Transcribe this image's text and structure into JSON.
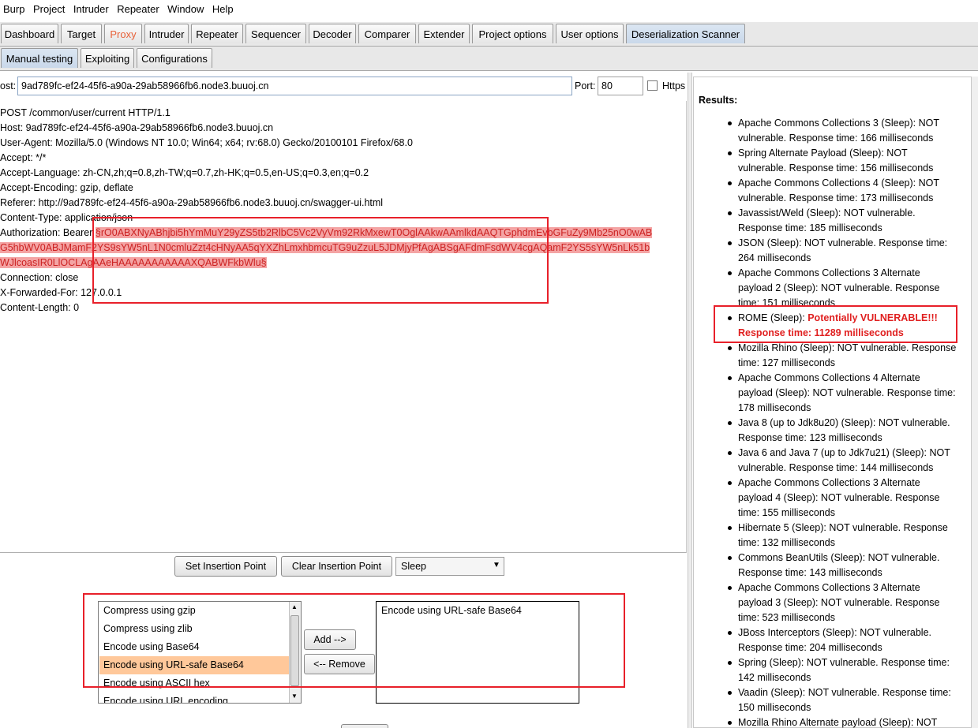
{
  "menu": [
    "Burp",
    "Project",
    "Intruder",
    "Repeater",
    "Window",
    "Help"
  ],
  "main_tabs": [
    "Dashboard",
    "Target",
    "Proxy",
    "Intruder",
    "Repeater",
    "Sequencer",
    "Decoder",
    "Comparer",
    "Extender",
    "Project options",
    "User options",
    "Deserialization Scanner"
  ],
  "sub_tabs": [
    "Manual testing",
    "Exploiting",
    "Configurations"
  ],
  "host": {
    "label": "ost:",
    "value": "9ad789fc-ef24-45f6-a90a-29ab58966fb6.node3.buuoj.cn",
    "port_label": "Port:",
    "port_value": "80",
    "https_label": "Https"
  },
  "request": {
    "l1": "POST /common/user/current HTTP/1.1",
    "l2": "Host: 9ad789fc-ef24-45f6-a90a-29ab58966fb6.node3.buuoj.cn",
    "l3": "User-Agent: Mozilla/5.0 (Windows NT 10.0; Win64; x64; rv:68.0) Gecko/20100101 Firefox/68.0",
    "l4": "Accept: */*",
    "l5": "Accept-Language: zh-CN,zh;q=0.8,zh-TW;q=0.7,zh-HK;q=0.5,en-US;q=0.3,en;q=0.2",
    "l6": "Accept-Encoding: gzip, deflate",
    "l7": "Referer: http://9ad789fc-ef24-45f6-a90a-29ab58966fb6.node3.buuoj.cn/swagger-ui.html",
    "l8": "Content-Type: application/json",
    "auth_prefix": "Authorization: Bearer ",
    "auth_1": "§rO0ABXNyABhjbi5hYmMuY29yZS5tb2RlbC5Vc2VyVm92RkMxewT0OglAAkwAAmlkdAAQTGphdmEvbGFuZy9Mb25nO0wAB",
    "auth_2": "G5hbWV0ABJMamF2YS9sYW5nL1N0cmluZzt4cHNyAA5qYXZhLmxhbmcuTG9uZzuL5JDMjyPfAgABSgAFdmFsdWV4cgAQamF2YS5sYW5nLk51b",
    "auth_3": "WJlcoasIR0LlOCLAgAAeHAAAAAAAAAAAXQABWFkbWlu§",
    "l10": "Connection: close",
    "l11": "X-Forwarded-For: 127.0.0.1",
    "l12": "Content-Length: 0"
  },
  "controls": {
    "set_insertion": "Set Insertion Point",
    "clear_insertion": "Clear Insertion Point",
    "mode": "Sleep",
    "add": "Add -->",
    "remove": "<-- Remove"
  },
  "encoders_available": [
    "Compress using gzip",
    "Compress using zlib",
    "Encode using Base64",
    "Encode using URL-safe Base64",
    "Encode using ASCII hex",
    "Encode using URL encoding"
  ],
  "encoders_selected": [
    "Encode using URL-safe Base64"
  ],
  "results": {
    "title": "Results:",
    "items": [
      {
        "a": "Apache Commons Collections 3 (Sleep): NOT",
        "b": "vulnerable. Response time: 166 milliseconds"
      },
      {
        "a": "Spring Alternate Payload (Sleep): NOT",
        "b": "vulnerable. Response time: 156 milliseconds"
      },
      {
        "a": "Apache Commons Collections 4 (Sleep): NOT",
        "b": "vulnerable. Response time: 173 milliseconds"
      },
      {
        "a": "Javassist/Weld (Sleep): NOT vulnerable.",
        "b": "Response time: 185 milliseconds"
      },
      {
        "a": "JSON (Sleep): NOT vulnerable. Response time:",
        "b": "264 milliseconds"
      },
      {
        "a": "Apache Commons Collections 3 Alternate",
        "b": "payload 2 (Sleep): NOT vulnerable. Response",
        "c": "time: 151 milliseconds"
      },
      {
        "a_prefix": "ROME (Sleep): ",
        "a_vuln": "Potentially VULNERABLE!!!",
        "b": "Response time: 11289 milliseconds"
      },
      {
        "a": "Mozilla Rhino (Sleep): NOT vulnerable. Response",
        "b": "time: 127 milliseconds"
      },
      {
        "a": "Apache Commons Collections 4 Alternate",
        "b": "payload (Sleep): NOT vulnerable. Response time:",
        "c": "178 milliseconds"
      },
      {
        "a": "Java 8 (up to Jdk8u20) (Sleep): NOT vulnerable.",
        "b": "Response time: 123 milliseconds"
      },
      {
        "a": "Java 6 and Java 7 (up to Jdk7u21) (Sleep): NOT",
        "b": "vulnerable. Response time: 144 milliseconds"
      },
      {
        "a": "Apache Commons Collections 3 Alternate",
        "b": "payload 4 (Sleep): NOT vulnerable. Response",
        "c": "time: 155 milliseconds"
      },
      {
        "a": "Hibernate 5 (Sleep): NOT vulnerable. Response",
        "b": "time: 132 milliseconds"
      },
      {
        "a": "Commons BeanUtils (Sleep): NOT vulnerable.",
        "b": "Response time: 143 milliseconds"
      },
      {
        "a": "Apache Commons Collections 3 Alternate",
        "b": "payload 3 (Sleep): NOT vulnerable. Response",
        "c": "time: 523 milliseconds"
      },
      {
        "a": "JBoss Interceptors (Sleep): NOT vulnerable.",
        "b": "Response time: 204 milliseconds"
      },
      {
        "a": "Spring (Sleep): NOT vulnerable. Response time:",
        "b": "142 milliseconds"
      },
      {
        "a": "Vaadin (Sleep): NOT vulnerable. Response time:",
        "b": "150 milliseconds"
      },
      {
        "a": "Mozilla Rhino Alternate payload (Sleep): NOT"
      }
    ]
  },
  "colors": {
    "highlight": "#f4a4a4",
    "highlight_text": "#cc2222",
    "annotation_box": "#e8202a",
    "vulnerable": "#e02020",
    "proxy_tab": "#e8623a",
    "selected_encoder": "#ffc89a"
  }
}
